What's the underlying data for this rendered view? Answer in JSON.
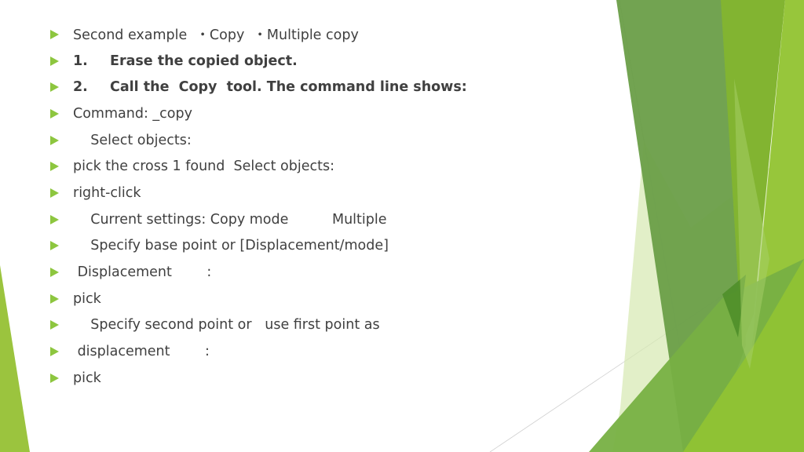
{
  "slide": {
    "accent_color": "#8dc63f",
    "bullets": [
      {
        "text": "Second example  ・Copy  ・Multiple copy",
        "bold": false
      },
      {
        "num": "1.",
        "text": "Erase the copied object.",
        "bold": true
      },
      {
        "num": "2.",
        "text": "Call the  Copy  tool. The command line shows:",
        "bold": true
      },
      {
        "text": "Command: _copy",
        "bold": false
      },
      {
        "text": "    Select objects:",
        "bold": false
      },
      {
        "text": "pick the cross 1 found  Select objects:",
        "bold": false
      },
      {
        "text": "right-click",
        "bold": false
      },
      {
        "text": "    Current settings: Copy mode          Multiple",
        "bold": false
      },
      {
        "text": "    Specify base point or [Displacement/mode]",
        "bold": false
      },
      {
        "text": " Displacement        :",
        "bold": false
      },
      {
        "text": "pick",
        "bold": false
      },
      {
        "text": "    Specify second point or   use first point as",
        "bold": false
      },
      {
        "text": " displacement        :",
        "bold": false
      },
      {
        "text": "pick",
        "bold": false
      }
    ]
  }
}
